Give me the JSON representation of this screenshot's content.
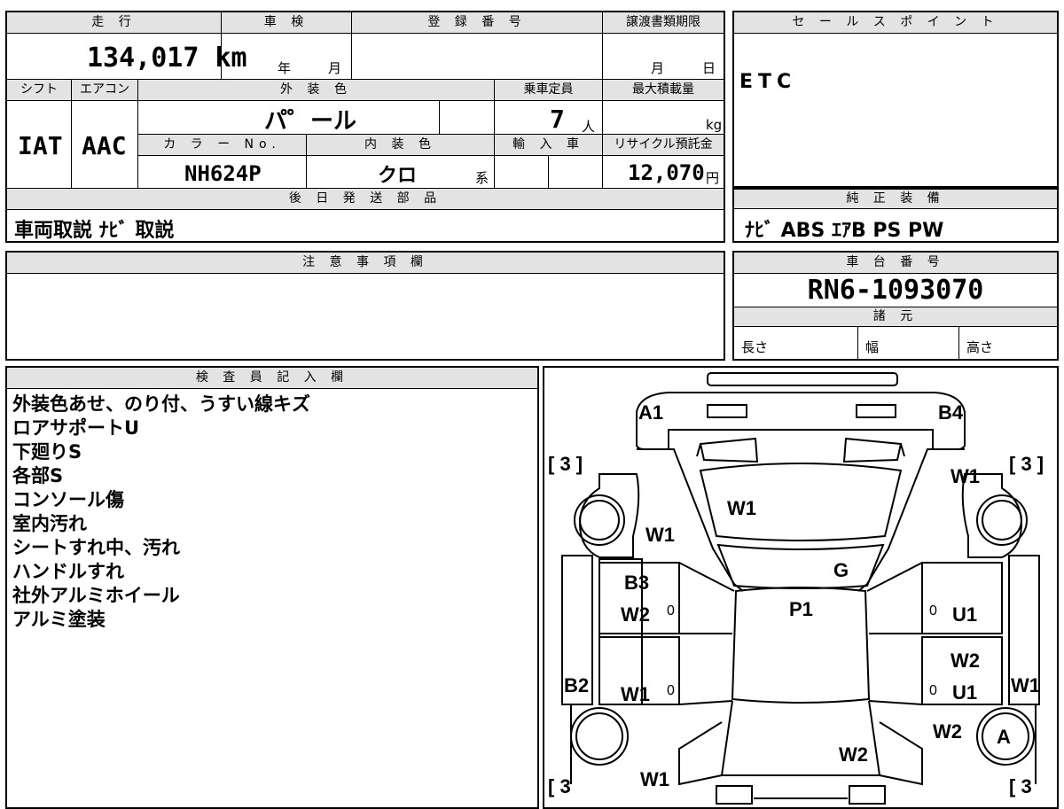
{
  "mileage": {
    "label": "走 行",
    "value": "134,017 km"
  },
  "inspection": {
    "label": "車 検",
    "year": "年",
    "month": "月"
  },
  "registration": {
    "label": "登 録 番 号"
  },
  "transfer": {
    "label": "譲渡書類期限",
    "month": "月",
    "day": "日"
  },
  "shift": {
    "label": "シフト",
    "value": "IAT"
  },
  "aircon": {
    "label": "エアコン",
    "value": "AAC"
  },
  "exterior_color": {
    "label": "外 装 色",
    "value": "パ゜ール"
  },
  "capacity": {
    "label": "乗車定員",
    "value": "7",
    "unit": "人"
  },
  "max_load": {
    "label": "最大積載量",
    "unit": "kg"
  },
  "color_no": {
    "label": "カ ラ ー No.",
    "value": "NH624P"
  },
  "interior_color": {
    "label": "内 装 色",
    "value": "クロ",
    "suffix": "系"
  },
  "import": {
    "label": "輸 入 車"
  },
  "recycle": {
    "label": "リサイクル預託金",
    "value": "12,070",
    "unit": "円"
  },
  "parts": {
    "label": "後 日 発 送 部 品",
    "value": "車両取説 ﾅﾋﾞ 取説"
  },
  "sales_point": {
    "label": "セ ー ル ス ポ イ ン ト",
    "value": "ETC"
  },
  "equipment": {
    "label": "純 正 装 備",
    "value": "ﾅﾋﾞ ABS ｴｱB PS PW"
  },
  "caution": {
    "label": "注 意 事 項 欄"
  },
  "chassis": {
    "label": "車 台 番 号",
    "value": "RN6-1093070"
  },
  "specs": {
    "label": "諸 元",
    "length": "長さ",
    "width": "幅",
    "height": "高さ"
  },
  "inspector": {
    "label": "検 査 員 記 入 欄",
    "notes": [
      "外装色あせ、のり付、うすい線キズ",
      "ロアサポートU",
      "下廻りS",
      "各部S",
      "コンソール傷",
      "室内汚れ",
      "シートすれ中、汚れ",
      "ハンドルすれ",
      "社外アルミホイール",
      "アルミ塗装"
    ]
  },
  "diagram": {
    "marks": {
      "a1": "A1",
      "b4": "B4",
      "w1_front_left": "W1",
      "w1_hood": "W1",
      "w1_front_right": "W1",
      "g": "G",
      "b3": "B3",
      "w2_left": "W2",
      "p1": "P1",
      "u1_right_top": "U1",
      "w2_right": "W2",
      "b2": "B2",
      "w1_left_lower": "W1",
      "u1_right_lower": "U1",
      "w1_right_side": "W1",
      "w2_rear_right": "W2",
      "a_tire": "A",
      "w2_rear": "W2",
      "w1_rear_left": "W1",
      "zero1": "0",
      "zero2": "0",
      "zero3": "0",
      "zero4": "0"
    },
    "tire_brackets": {
      "fl": "[ 3 ]",
      "fr": "[ 3 ]",
      "rl": "[ 3",
      "rr": "[ 3"
    }
  }
}
